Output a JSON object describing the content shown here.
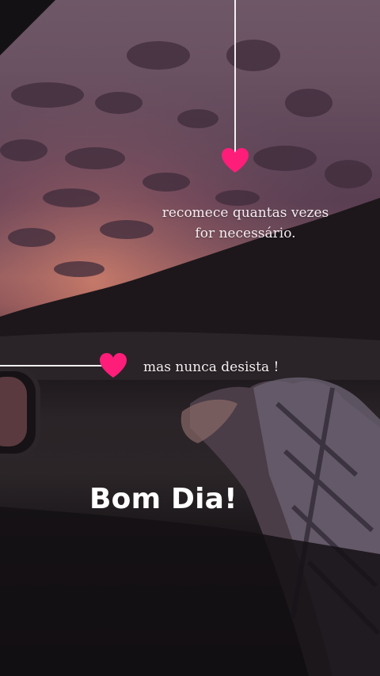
{
  "captions": {
    "line1": "recomece quantas vezes",
    "line2": "for necessário.",
    "line3": "mas nunca desista !"
  },
  "greeting": "Bom Dia!",
  "icons": {
    "top_heart": "heart-icon",
    "left_heart": "heart-icon"
  },
  "colors": {
    "heart": "#ff1d7a",
    "connector_line": "#f3f1f2",
    "caption_text": "#f4eef0",
    "greeting_text": "#ffffff"
  }
}
